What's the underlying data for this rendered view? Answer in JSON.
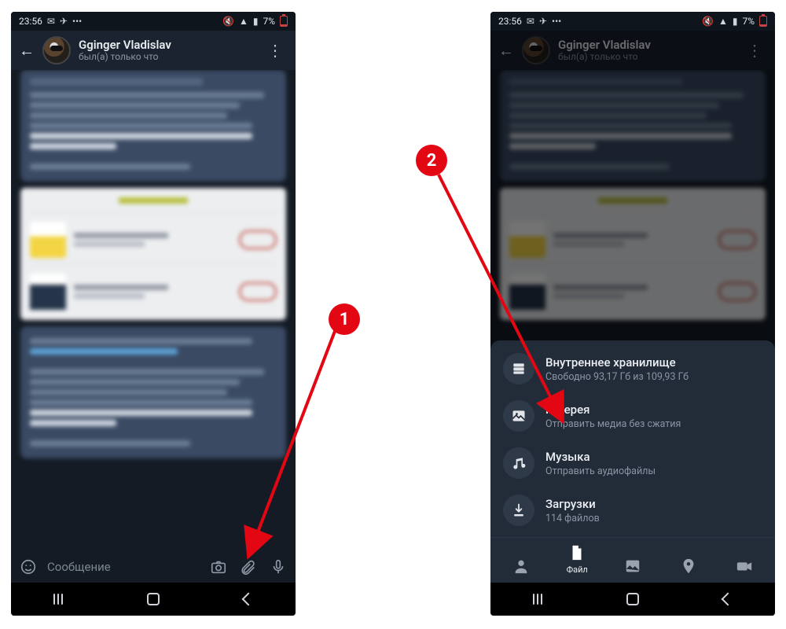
{
  "statusbar": {
    "time": "23:56",
    "battery_pct": "7%"
  },
  "chat": {
    "name": "Gginger Vladislav",
    "status": "был(а) только что"
  },
  "input": {
    "placeholder": "Сообщение"
  },
  "sheet": {
    "items": [
      {
        "title": "Внутреннее хранилище",
        "subtitle": "Свободно 93,17 Гб из 109,93 Гб",
        "icon": "storage"
      },
      {
        "title": "Галерея",
        "subtitle": "Отправить медиа без сжатия",
        "icon": "gallery"
      },
      {
        "title": "Музыка",
        "subtitle": "Отправить аудиофайлы",
        "icon": "music"
      },
      {
        "title": "Загрузки",
        "subtitle": "114 файлов",
        "icon": "download"
      }
    ],
    "tabs": {
      "file_label": "Файл"
    }
  },
  "annotations": {
    "step1": "1",
    "step2": "2"
  }
}
